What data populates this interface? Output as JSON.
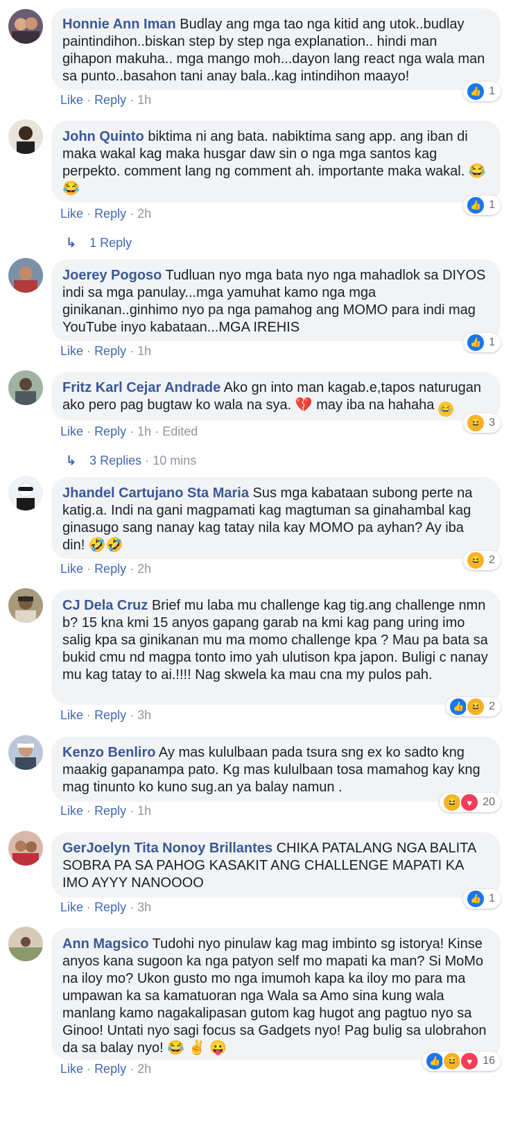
{
  "labels": {
    "like": "Like",
    "reply": "Reply",
    "sep": "·"
  },
  "colors": {
    "author": "#385898",
    "link": "#4267b2",
    "meta": "#90949c",
    "bubble": "#f2f3f5",
    "like_blue": "#1877f2",
    "haha_yellow": "#f7b125",
    "love_red": "#f33e58"
  },
  "comments": [
    {
      "author": "Honnie Ann Iman",
      "text": "Budlay ang mga tao nga kitid ang utok..budlay paintindihon..biskan step by step nga explanation.. hindi man gihapon makuha.. mga mango moh...dayon lang react nga wala man sa punto..basahon tani anay bala..kag intindihon maayo!",
      "time": "1h",
      "reaction_count": "1",
      "reactions": [
        "like-icon"
      ]
    },
    {
      "author": "John Quinto",
      "text": "biktima ni ang bata. nabiktima sang app. ang iban di maka wakal kag maka husgar daw sin o nga mga santos kag perpekto. comment lang ng comment ah. importante maka wakal.",
      "emoji": "😂😂",
      "time": "2h",
      "reaction_count": "1",
      "reactions": [
        "like-icon"
      ],
      "replies_label": "1 Reply"
    },
    {
      "author": "Joerey Pogoso",
      "text": "Tudluan nyo mga bata nyo nga mahadlok sa DIYOS indi sa mga panulay...mga yamuhat kamo nga mga ginikanan..ginhimo nyo pa nga pamahog ang MOMO para indi mag YouTube inyo kabataan...MGA IREHIS",
      "time": "1h",
      "reaction_count": "1",
      "reactions": [
        "like-icon"
      ]
    },
    {
      "author": "Fritz Karl Cejar Andrade",
      "text": "Ako gn into man kagab.e,tapos naturugan ako pero pag bugtaw ko wala na sya.",
      "text_after": "may iba na hahaha",
      "time": "1h",
      "edited": "Edited",
      "reaction_count": "3",
      "reactions": [
        "haha-icon"
      ],
      "replies_label": "3 Replies",
      "replies_time": "10 mins"
    },
    {
      "author": "Jhandel Cartujano Sta Maria",
      "text": "Sus mga kabataan subong perte na katig.a. Indi na gani magpamati kag magtuman sa ginahambal kag ginasugo sang nanay kag tatay nila kay MOMO pa ayhan? Ay iba din!",
      "emoji": "🤣🤣",
      "time": "2h",
      "reaction_count": "2",
      "reactions": [
        "haha-icon"
      ]
    },
    {
      "author": "CJ Dela Cruz",
      "text": "Brief mu laba mu challenge kag tig.ang challenge nmn b? 15 kna kmi 15 anyos gapang garab na kmi kag pang uring imo salig kpa sa ginikanan mu ma momo challenge kpa ? Mau pa bata sa bukid cmu nd magpa tonto imo yah ulutison kpa japon. Buligi c nanay mu kag tatay to ai.!!!! Nag skwela ka mau cna my pulos pah.",
      "time": "3h",
      "reaction_count": "2",
      "reactions": [
        "like-icon",
        "haha-icon"
      ]
    },
    {
      "author": "Kenzo Benliro",
      "text": "Ay mas kululbaan pada tsura sng ex ko sadto kng maakig gapanampa pato. Kg mas kululbaan tosa mamahog kay kng mag tinunto ko kuno sug.an ya balay namun .",
      "time": "1h",
      "reaction_count": "20",
      "reactions": [
        "haha-icon",
        "love-icon"
      ]
    },
    {
      "author": "GerJoelyn Tita Nonoy Brillantes",
      "text": "CHIKA PATALANG NGA BALITA SOBRA PA SA PAHOG KASAKIT ANG CHALLENGE MAPATI KA IMO AYYY NANOOOO",
      "time": "3h",
      "reaction_count": "1",
      "reactions": [
        "like-icon"
      ]
    },
    {
      "author": "Ann Magsico",
      "text": "Tudohi nyo pinulaw kag mag imbinto sg istorya! Kinse anyos kana sugoon ka nga patyon self mo mapati ka man? Si MoMo na iloy mo? Ukon gusto mo nga imumoh kapa ka iloy mo para ma umpawan ka sa kamatuoran nga Wala sa Amo sina kung wala manlang kamo nagakalipasan gutom kag hugot ang pagtuo nyo sa Ginoo! Untati nyo sagi focus sa Gadgets nyo! Pag bulig sa ulobrahon da sa balay nyo!",
      "emoji": "😂 ✌ 😛",
      "time": "2h",
      "reaction_count": "16",
      "reactions": [
        "like-icon",
        "haha-icon",
        "love-icon"
      ]
    }
  ]
}
